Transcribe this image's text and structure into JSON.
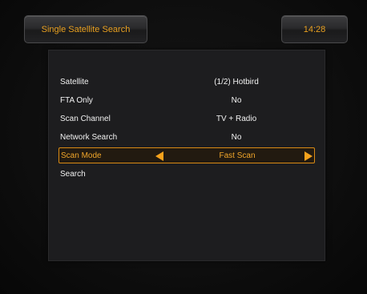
{
  "header": {
    "title": "Single Satellite Search",
    "clock": "14:28"
  },
  "menu": {
    "items": [
      {
        "label": "Satellite",
        "value": "(1/2) Hotbird"
      },
      {
        "label": "FTA Only",
        "value": "No"
      },
      {
        "label": "Scan Channel",
        "value": "TV + Radio"
      },
      {
        "label": "Network Search",
        "value": "No"
      },
      {
        "label": "Scan Mode",
        "value": "Fast Scan"
      },
      {
        "label": "Search",
        "value": ""
      }
    ],
    "selected_index": 4
  },
  "colors": {
    "accent": "#f0a52a",
    "text": "#f2f2f2",
    "background": "#0e0e0e",
    "panel": "#1d1d1f"
  },
  "icons": {
    "left": "left-arrow-icon",
    "right": "right-arrow-icon"
  }
}
